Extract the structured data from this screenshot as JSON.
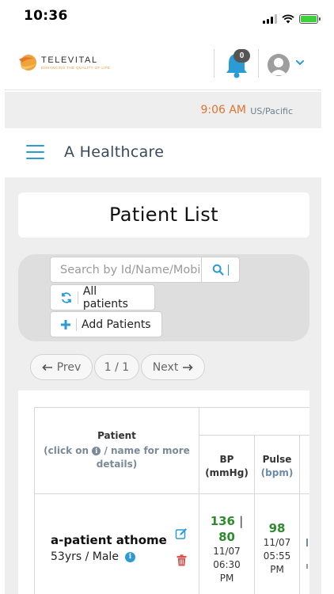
{
  "status_bar": {
    "time": "10:36"
  },
  "header": {
    "logo_text": "TELEVITAL",
    "logo_tagline": "ENHANCING THE QUALITY OF LIFE",
    "notification_count": "0"
  },
  "time_bar": {
    "time": "9:06 AM",
    "timezone": "US/Pacific"
  },
  "org": {
    "name": "A Healthcare"
  },
  "page": {
    "title": "Patient List"
  },
  "filters": {
    "search_placeholder": "Search by Id/Name/Mobile",
    "all_patients_label": "All patients",
    "add_patients_label": "Add Patients"
  },
  "pagination": {
    "prev_label": "Prev",
    "page_indicator": "1 / 1",
    "next_label": "Next"
  },
  "table": {
    "headers": {
      "patient": "Patient",
      "patient_hint_pre": "(click on",
      "patient_hint_post": "/ name for more details)",
      "bp": "BP",
      "bp_unit": "(mmHg)",
      "pulse": "Pulse",
      "pulse_unit": "(bpm)"
    },
    "rows": [
      {
        "name": "a-patient athome",
        "details": "53yrs / Male",
        "bp_systolic": "136",
        "bp_diastolic": "80",
        "bp_date": "11/07",
        "bp_time": "06:30",
        "bp_ampm": "PM",
        "pulse": "98",
        "pulse_date": "11/07",
        "pulse_time": "05:55",
        "pulse_ampm": "PM"
      }
    ]
  },
  "colors": {
    "accent_blue": "#2b9bd6",
    "time_orange": "#e0732f",
    "vital_green": "#2e8b2e",
    "delete_red": "#d9534f"
  }
}
